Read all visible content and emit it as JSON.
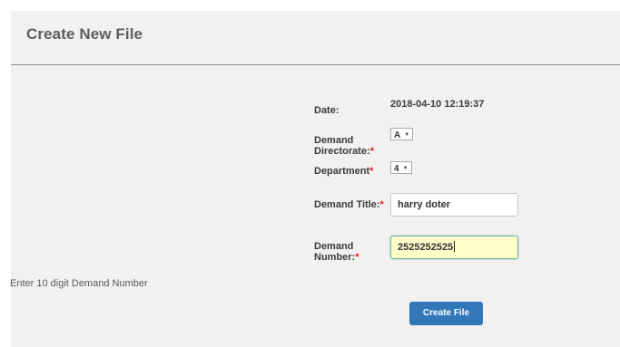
{
  "header": {
    "title": "Create New File"
  },
  "form": {
    "date": {
      "label": "Date:",
      "value": "2018-04-10 12:19:37"
    },
    "demand_directorate": {
      "label_line1": "Demand",
      "label_line2": "Directorate:",
      "required_mark": "*",
      "selected": "A"
    },
    "department": {
      "label": "Department",
      "required_mark": "*",
      "selected": "4"
    },
    "demand_title": {
      "label": "Demand Title:",
      "required_mark": "*",
      "value": "harry doter"
    },
    "demand_number": {
      "label_line1": "Demand",
      "label_line2": "Number:",
      "required_mark": "*",
      "value": "2525252525"
    },
    "hint": "Enter 10 digit Demand Number",
    "submit_label": "Create File"
  },
  "colors": {
    "panel_background": "#f2f1ef",
    "button_blue": "#3278b8",
    "required_red": "#e02020",
    "focused_input_bg": "#fdfec8"
  }
}
